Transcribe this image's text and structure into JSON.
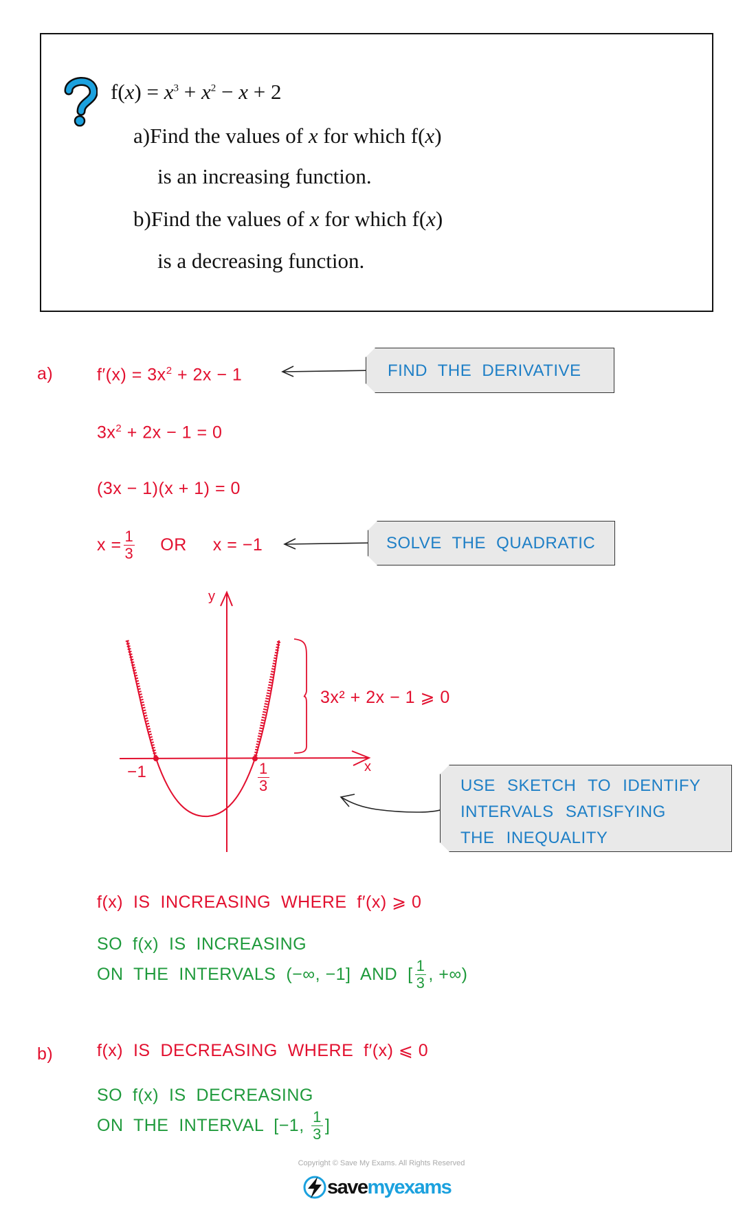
{
  "question": {
    "icon": "question-mark-icon",
    "function": {
      "lhs": "f(",
      "var": "x",
      "rhs": ") = ",
      "t1": "x",
      "e1": "3",
      "p1": " + ",
      "t2": "x",
      "e2": "2",
      "p2": " − ",
      "t3": "x",
      "p3": " + 2"
    },
    "part_a": {
      "label": "a)",
      "text1": "Find the values of ",
      "var": "x",
      "text2": " for which f(",
      "var2": "x",
      "text3": ")",
      "line2": "is an increasing function."
    },
    "part_b": {
      "label": "b)",
      "text1": "Find the values of ",
      "var": "x",
      "text2": " for which f(",
      "var2": "x",
      "text3": ")",
      "line2": "is a decreasing function."
    }
  },
  "solution_a": {
    "label": "a)",
    "step1": {
      "text": "f′(x) = 3x",
      "sup": "2",
      "rest": " + 2x − 1"
    },
    "tag1": "FIND THE DERIVATIVE",
    "step2": {
      "text": "3x",
      "sup": "2",
      "rest": " + 2x − 1 = 0"
    },
    "step3": "(3x − 1)(x + 1) = 0",
    "step4": {
      "lhs": "x =",
      "num": "1",
      "den": "3",
      "or": "OR",
      "rhs": "x = −1"
    },
    "tag2": "SOLVE THE QUADRATIC",
    "graph": {
      "y_label": "y",
      "x_label": "x",
      "root1": "−1",
      "root2_num": "1",
      "root2_den": "3",
      "inequality": "3x² + 2x − 1 ⩾ 0"
    },
    "tag3": [
      "USE SKETCH TO IDENTIFY",
      "INTERVALS SATISFYING",
      "THE INEQUALITY"
    ],
    "condition": "f(x)  IS  INCREASING  WHERE  f′(x) ⩾ 0",
    "conclusion1": "SO  f(x)  IS  INCREASING",
    "conclusion2": {
      "text": "ON  THE  INTERVALS  (−∞, −1]  AND  [",
      "num": "1",
      "den": "3",
      "end": ", +∞)"
    }
  },
  "solution_b": {
    "label": "b)",
    "condition": "f(x)  IS  DECREASING  WHERE  f′(x) ⩽ 0",
    "conclusion1": "SO  f(x)  IS  DECREASING",
    "conclusion2": {
      "text": "ON  THE  INTERVAL  [−1, ",
      "num": "1",
      "den": "3",
      "end": "]"
    }
  },
  "footer": {
    "copyright": "Copyright © Save My Exams. All Rights Reserved",
    "logo_a": "save",
    "logo_b": "myexams"
  },
  "colors": {
    "working": "#e2102f",
    "answer": "#1f9a3c",
    "annotation": "#1e7fc6",
    "tag_bg": "#e9e9e9",
    "icon": "#1ba1de"
  }
}
